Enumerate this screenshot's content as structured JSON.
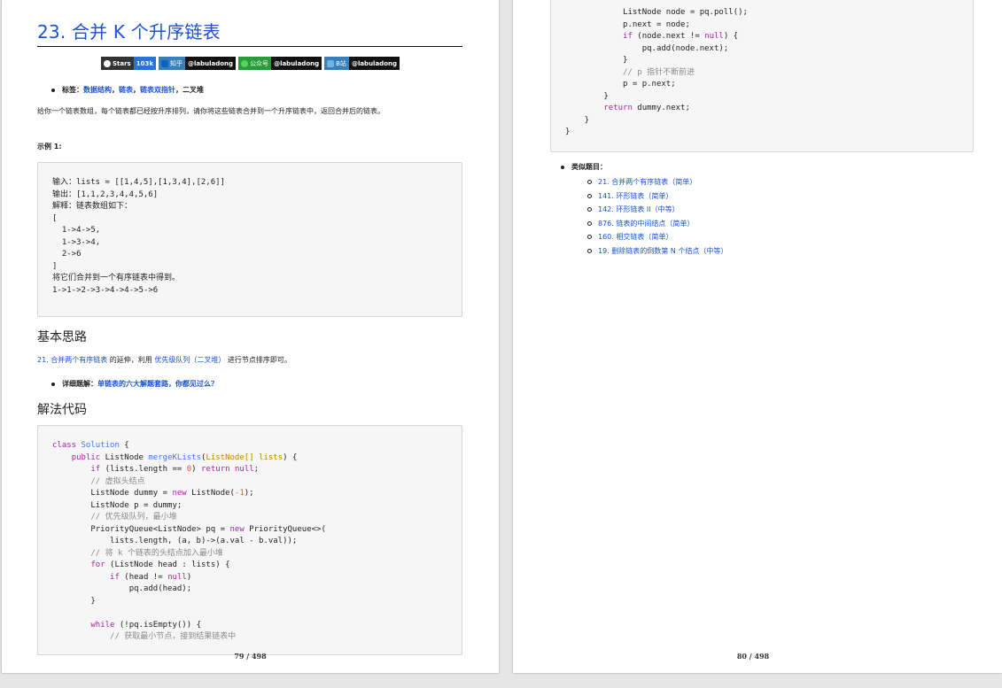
{
  "left_page": {
    "title": "23. 合并 K 个升序链表",
    "badges": [
      {
        "name": "Stars",
        "value": "103k"
      },
      {
        "name": "知乎",
        "value": "@labuladong"
      },
      {
        "name": "公众号",
        "value": "@labuladong"
      },
      {
        "name": "B站",
        "value": "@labuladong"
      }
    ],
    "tags_label": "标签：",
    "tags": [
      "数据结构",
      "链表",
      "链表双指针"
    ],
    "tags_sep": "，",
    "tags_tail": "，二叉堆",
    "description": "给你一个链表数组，每个链表都已经按升序排列，请你将这些链表合并到一个升序链表中，返回合并后的链表。",
    "example_heading": "示例 1:",
    "example_lines": [
      "输入：lists = [[1,4,5],[1,3,4],[2,6]]",
      "输出：[1,1,2,3,4,4,5,6]",
      "解释：链表数组如下：",
      "[",
      "  1->4->5,",
      "  1->3->4,",
      "  2->6",
      "]",
      "将它们合并到一个有序链表中得到。",
      "1->1->2->3->4->4->5->6"
    ],
    "section_idea": "基本思路",
    "idea_link1": "21. 合并两个有序链表",
    "idea_mid": " 的延伸，利用 ",
    "idea_link2": "优先级队列（二叉堆）",
    "idea_tail": " 进行节点排序即可。",
    "detail_label": "详细题解：",
    "detail_link": "单链表的六大解题套路，你都见过么？",
    "section_code": "解法代码",
    "page_number": "79 / 498"
  },
  "right_page": {
    "similar_label": "类似题目：",
    "similar_items": [
      "21. 合并两个有序链表（简单）",
      "141. 环形链表（简单）",
      "142. 环形链表 II（中等）",
      "876. 链表的中间结点（简单）",
      "160. 相交链表（简单）",
      "19. 删除链表的倒数第 N 个结点（中等）"
    ],
    "page_number": "80 / 498"
  },
  "colors": {
    "link": "#1a52d6",
    "keyword": "#a626a4",
    "class_name": "#4078f2",
    "number": "#e45649",
    "comment": "#8a8a8a",
    "param": "#c18401"
  }
}
